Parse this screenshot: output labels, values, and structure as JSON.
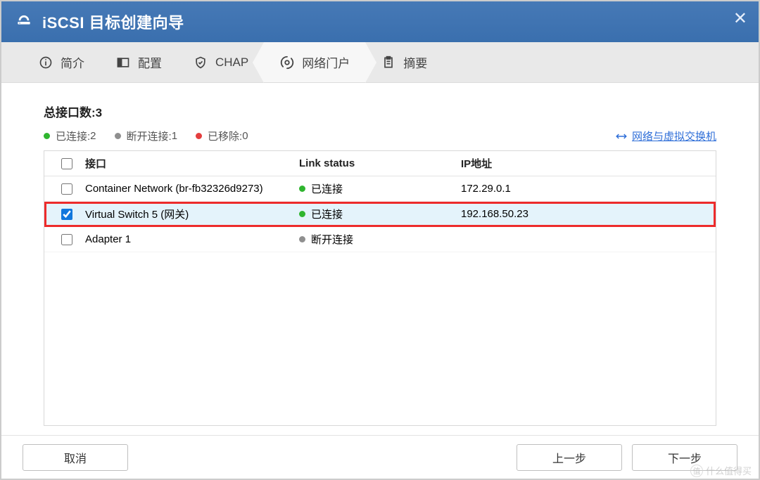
{
  "titlebar": {
    "title": "iSCSI 目标创建向导"
  },
  "steps": {
    "intro": "简介",
    "config": "配置",
    "chap": "CHAP",
    "portal": "网络门户",
    "summary": "摘要"
  },
  "content": {
    "total_prefix": "总接口数:",
    "total_count": "3",
    "status": {
      "connected_label": "已连接:",
      "connected_count": " 2",
      "disconnected_label": "断开连接:",
      "disconnected_count": " 1",
      "removed_label": "已移除:",
      "removed_count": " 0"
    },
    "switch_link": "网络与虚拟交换机",
    "table": {
      "headers": {
        "interface": "接口",
        "link": "Link status",
        "ip": "IP地址"
      },
      "rows": [
        {
          "checked": false,
          "iface": "Container Network (br-fb32326d9273)",
          "status_dot": "green",
          "status": "已连接",
          "ip": "172.29.0.1",
          "highlight": false
        },
        {
          "checked": true,
          "iface": "Virtual Switch 5 (网关)",
          "status_dot": "green",
          "status": "已连接",
          "ip": "192.168.50.23",
          "highlight": true
        },
        {
          "checked": false,
          "iface": "Adapter 1",
          "status_dot": "gray",
          "status": "断开连接",
          "ip": "",
          "highlight": false
        }
      ]
    }
  },
  "footer": {
    "cancel": "取消",
    "prev": "上一步",
    "next": "下一步"
  },
  "watermark": "什么值得买"
}
